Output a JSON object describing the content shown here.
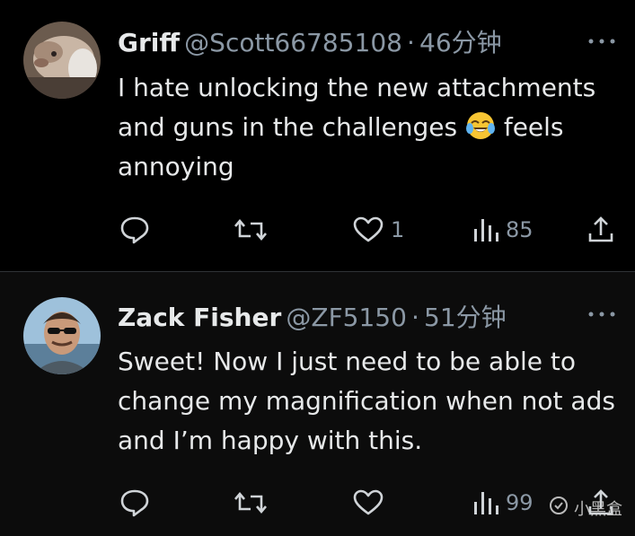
{
  "tweets": [
    {
      "name": "Griff",
      "handle": "@Scott66785108",
      "separator": "·",
      "time": "46分钟",
      "text_before_emoji": "I hate unlocking the new attachments and guns in the challenges ",
      "emoji": "face-with-tears-of-joy",
      "text_after_emoji": " feels annoying",
      "reply_count": "",
      "retweet_count": "",
      "like_count": "1",
      "view_count": "85"
    },
    {
      "name": "Zack Fisher",
      "handle": "@ZF5150",
      "separator": "·",
      "time": "51分钟",
      "text": "Sweet! Now I just need to be able to change my magnification when not ads and I’m happy with this.",
      "reply_count": "",
      "retweet_count": "",
      "like_count": "",
      "view_count": "99"
    }
  ],
  "watermark": {
    "text": "小黑盒"
  },
  "colors": {
    "background": "#000000",
    "text": "#e7e9ea",
    "muted": "#8b98a5",
    "divider": "#2f3336"
  }
}
